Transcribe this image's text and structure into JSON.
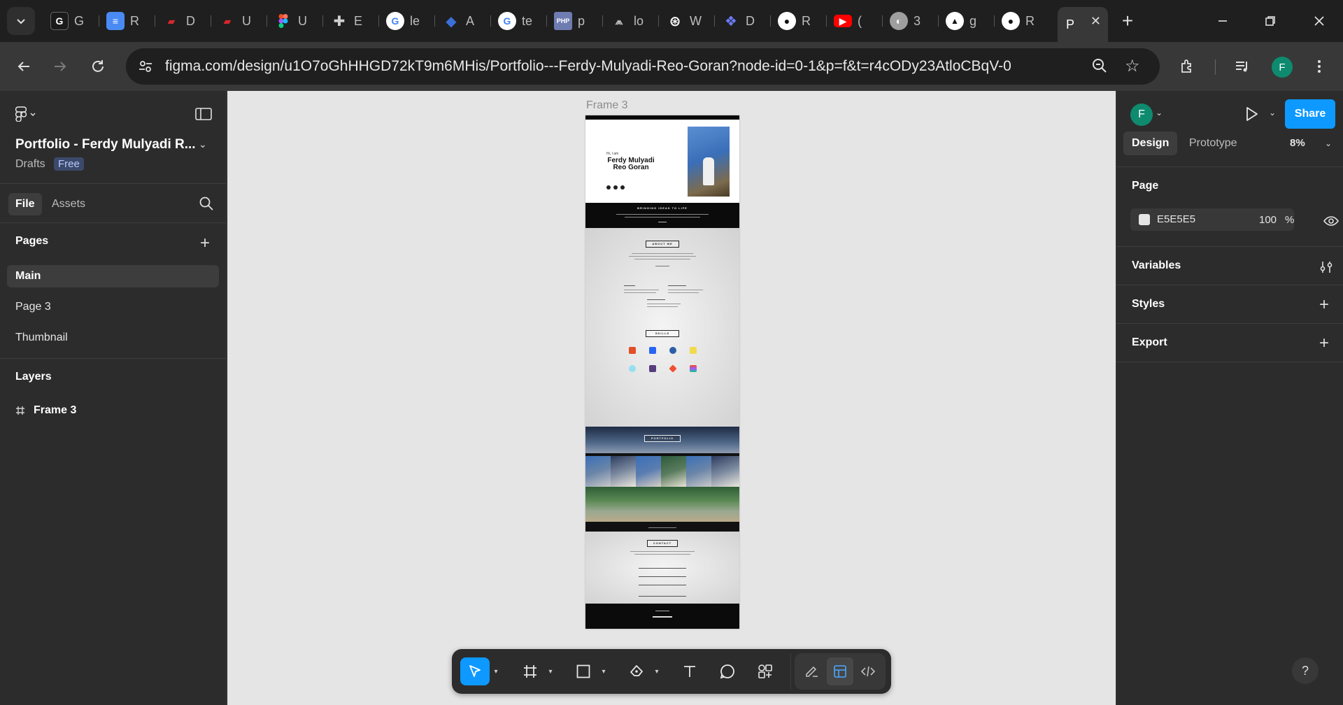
{
  "browser": {
    "tabs": [
      {
        "title": "G",
        "icon": "google-scholar-icon",
        "color": "#4285f4"
      },
      {
        "title": "R",
        "icon": "google-docs-icon",
        "color": "#4a8af4"
      },
      {
        "title": "D",
        "icon": "dicoding-icon",
        "color": "#d8262d"
      },
      {
        "title": "U",
        "icon": "dicoding-icon",
        "color": "#d8262d"
      },
      {
        "title": "U",
        "icon": "figma-icon",
        "color": "#f24e1e"
      },
      {
        "title": "E",
        "icon": "extensions-icon",
        "color": "#9e9e9e"
      },
      {
        "title": "le",
        "icon": "google-icon",
        "color": "#4285f4"
      },
      {
        "title": "A",
        "icon": "graduation-cap-icon",
        "color": "#3a6fd8"
      },
      {
        "title": "te",
        "icon": "google-icon",
        "color": "#4285f4"
      },
      {
        "title": "p",
        "icon": "php-icon",
        "color": "#6f7cb2"
      },
      {
        "title": "lo",
        "icon": "mountain-logo-icon",
        "color": "#c9c9c9"
      },
      {
        "title": "W",
        "icon": "openai-icon",
        "color": "#ffffff"
      },
      {
        "title": "D",
        "icon": "copilot-icon",
        "color": "#6b7cff"
      },
      {
        "title": "R",
        "icon": "github-icon",
        "color": "#ffffff"
      },
      {
        "title": "(",
        "icon": "youtube-icon",
        "color": "#ff0000"
      },
      {
        "title": "3",
        "icon": "globe-icon",
        "color": "#9e9e9e"
      },
      {
        "title": "g",
        "icon": "vercel-icon",
        "color": "#ffffff"
      },
      {
        "title": "R",
        "icon": "github-icon",
        "color": "#ffffff"
      }
    ],
    "active_tab": {
      "title": "P"
    },
    "url": "figma.com/design/u1O7oGhHHGD72kT9m6MHis/Portfolio---Ferdy-Mulyadi-Reo-Goran?node-id=0-1&p=f&t=r4cODy23AtloCBqV-0",
    "profile_initial": "F"
  },
  "left_panel": {
    "file_title": "Portfolio - Ferdy Mulyadi R...",
    "location": "Drafts",
    "plan_badge": "Free",
    "tabs": {
      "file": "File",
      "assets": "Assets"
    },
    "pages_heading": "Pages",
    "pages": [
      "Main",
      "Page 3",
      "Thumbnail"
    ],
    "selected_page": "Main",
    "layers_heading": "Layers",
    "layers": [
      "Frame 3"
    ]
  },
  "canvas": {
    "background": "#e5e5e5",
    "frame_label": "Frame 3",
    "frame_content": {
      "greeting": "Hi, I am",
      "name": "Ferdy Mulyadi Reo Goran",
      "tagline": "BRINGING IDEAS TO LIFE",
      "sections": [
        "ABOUT ME",
        "SKILLS",
        "PORTFOLIO",
        "CONTACT"
      ],
      "skills": [
        "HTML5",
        "CSS3",
        "C",
        "JAVASCRIPT",
        "REACT",
        "BOOTSTRAP",
        "GIT",
        "FIGMA"
      ]
    }
  },
  "bottom_toolbar": {
    "tools": [
      "move-tool",
      "frame-tool",
      "shape-tool",
      "pen-tool",
      "text-tool",
      "comment-tool",
      "actions-tool"
    ],
    "modes": [
      "draw-mode",
      "design-mode",
      "dev-mode"
    ]
  },
  "right_panel": {
    "user_initial": "F",
    "share_label": "Share",
    "tabs": {
      "design": "Design",
      "prototype": "Prototype"
    },
    "zoom": "8%",
    "page_heading": "Page",
    "page_color": "E5E5E5",
    "page_opacity": "100",
    "opacity_unit": "%",
    "variables_heading": "Variables",
    "styles_heading": "Styles",
    "export_heading": "Export",
    "help_label": "?"
  },
  "colors": {
    "accent": "#0d99ff",
    "avatar": "#0e8a6f",
    "panel": "#2c2c2c",
    "canvas": "#e5e5e5"
  }
}
